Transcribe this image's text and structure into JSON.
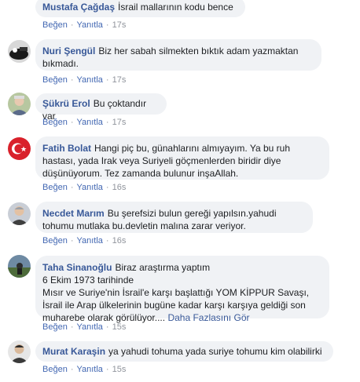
{
  "actions": {
    "like": "Beğen",
    "reply": "Yanıtla",
    "sep": "·"
  },
  "comments": [
    {
      "name": "Mustafa Çağdaş",
      "text": "İsrail mallarının kodu bence",
      "time": "17s"
    },
    {
      "name": "Nuri Şengül",
      "text": "Biz her sabah silmekten bıktık adam yazmaktan bıkmadı.",
      "time": "17s"
    },
    {
      "name": "Şükrü Erol",
      "text": "Bu çoktandır var",
      "time": "17s"
    },
    {
      "name": "Fatih Bolat",
      "text": "Hangi piç bu, günahlarını almıyayım. Ya bu ruh hastası, yada Irak veya Suriyeli göçmenlerden biridir diye düşünüyorum. Tez zamanda bulunur inşaAllah.",
      "time": "16s"
    },
    {
      "name": "Necdet Marım",
      "text": "Bu şerefsizi bulun gereği yapılsın.yahudi tohumu mutlaka bu.devletin malına zarar veriyor.",
      "time": "16s"
    },
    {
      "name": "Taha Sinanoğlu",
      "text": "Biraz araştırma yaptım\n6 Ekim 1973 tarihinde\nMısır ve Suriye'nin İsrail'e karşı başlattığı YOM KİPPUR Savaşı, İsrail ile Arap ülkelerinin bugüne kadar karşı karşıya geldiği son muharebe olarak görülüyor....",
      "more": "Daha Fazlasını Gör",
      "time": "15s"
    },
    {
      "name": "Murat Karaşin",
      "text": "ya yahudi tohuma yada suriye tohumu kim olabilirki",
      "time": "15s"
    }
  ]
}
